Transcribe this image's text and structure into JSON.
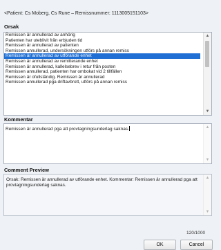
{
  "header": {
    "title": "<Patient: Cs Moberg, Cs Rune – Remissnummer: 1113005151103>"
  },
  "orsak": {
    "label": "Orsak",
    "items": [
      "Remissen är annullerad av anhörig",
      "Patienten har uteblivit från erbjuden tid",
      "Remissen är annullerad av patienten",
      "Remissen annullerad, undersökningen utförs på annan remiss",
      "Remissen är annullerad av utförande enhet",
      "Remissen är annullerad av remitterande enhet",
      "Remissen är annullerad, kallelsebrev i retur från posten",
      "Remissen annullerad, patienten har ombokat vid 2 tillfällen",
      "Remissen är ofullständig. Remissen är annullerad",
      "Remissen annullerad pga driftavbrott, utförs på annan remiss"
    ],
    "selected_item": "Remissen är annullerad av utförande enhet"
  },
  "kommentar": {
    "label": "Kommentar",
    "value": "Remissen är annullerad pga att provtagningsunderlag saknas."
  },
  "preview": {
    "label": "Comment Preview",
    "text": "Orsak: Remissen är annullerad av utförande enhet. Kommentar: Remissen är annullerad pga att provtagningsunderlag saknas."
  },
  "counter": "120/1000",
  "buttons": {
    "ok": "OK",
    "cancel": "Cancel"
  },
  "icons": {
    "scroll_up": "chevron-up-icon",
    "scroll_down": "chevron-down-icon"
  },
  "colors": {
    "selection": "#1f6fd4",
    "background": "#eef1f5"
  }
}
